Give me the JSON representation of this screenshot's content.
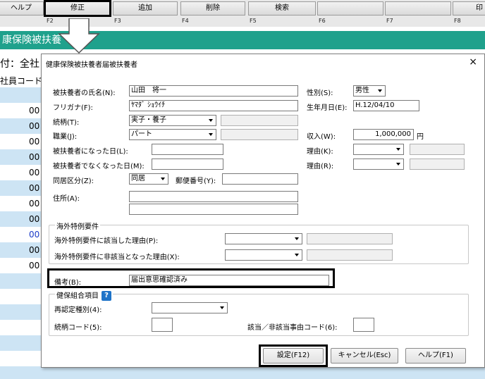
{
  "toolbar": {
    "buttons": [
      "ヘルプ",
      "修正",
      "追加",
      "削除",
      "検索",
      "",
      "",
      "印"
    ],
    "fkeys": [
      "F2",
      "F3",
      "F4",
      "F5",
      "F6",
      "F7",
      "F8"
    ]
  },
  "background": {
    "banner": "康保険被扶養",
    "company_label": "付：全社",
    "column_header": "社員コード",
    "row_codes": [
      "00",
      "00",
      "00",
      "00",
      "00",
      "00",
      "00",
      "00",
      "00",
      "00",
      "00"
    ]
  },
  "dialog": {
    "title": "健康保険被扶養者届被扶養者",
    "close": "×",
    "fields": {
      "name_label": "被扶養者の氏名(N):",
      "name_value": "山田　将一",
      "kana_label": "フリガナ(F):",
      "kana_value": "ﾔﾏﾀﾞ ｼｮｳｲﾁ",
      "relation_label": "続柄(T):",
      "relation_value": "実子・養子",
      "job_label": "職業(J):",
      "job_value": "パート",
      "became_label": "被扶養者になった日(L):",
      "stopped_label": "被扶養者でなくなった日(M):",
      "cohabit_label": "同居区分(Z):",
      "cohabit_value": "同居",
      "postal_label": "郵便番号(Y):",
      "address_label": "住所(A):",
      "sex_label": "性別(S):",
      "sex_value": "男性",
      "birth_label": "生年月日(E):",
      "birth_value": "H.12/04/10",
      "income_label": "収入(W):",
      "income_value": "1,000,000",
      "income_unit": "円",
      "reason_k_label": "理由(K):",
      "reason_r_label": "理由(R):"
    },
    "overseas": {
      "title": "海外特例要件",
      "applicable_label": "海外特例要件に該当した理由(P):",
      "not_applicable_label": "海外特例要件に非該当となった理由(X):"
    },
    "remarks_label": "備考(B):",
    "remarks_value": "届出意思確認済み",
    "union": {
      "title": "健保組合項目",
      "help_icon": "?",
      "recert_label": "再認定種別(4):",
      "relation_code_label": "続柄コード(5):",
      "reason_code_label": "該当／非該当事由コード(6):"
    },
    "buttons": {
      "ok": "設定(F12)",
      "cancel": "キャンセル(Esc)",
      "help": "ヘルプ(F1)"
    }
  }
}
